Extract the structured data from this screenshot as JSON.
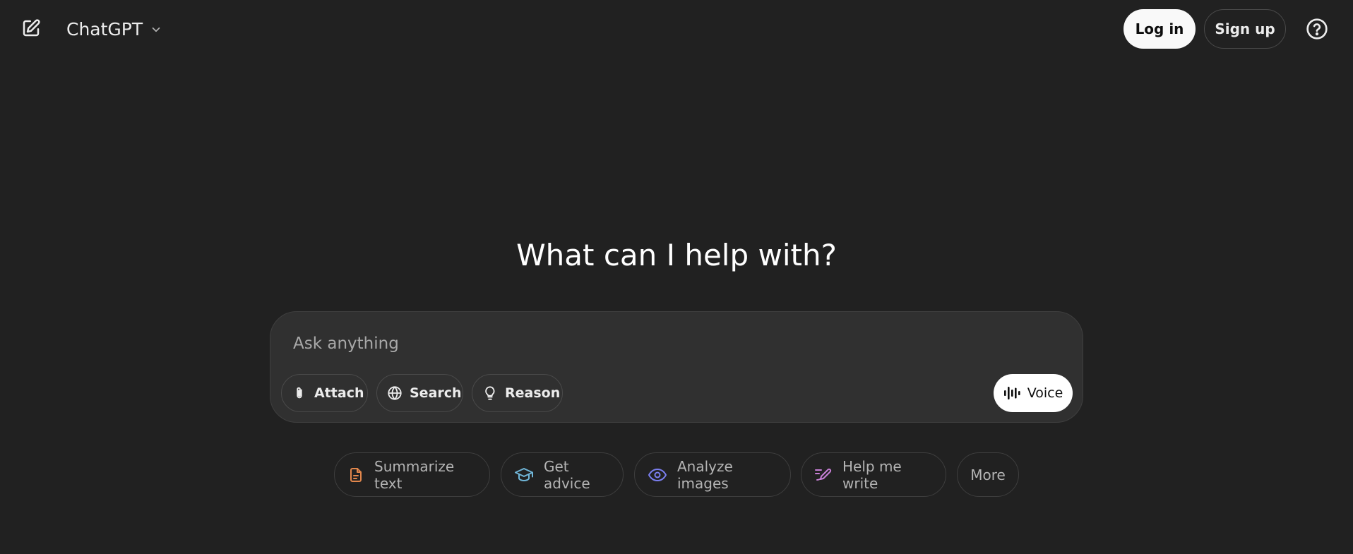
{
  "header": {
    "model_name": "ChatGPT",
    "login_label": "Log in",
    "signup_label": "Sign up",
    "icons": {
      "new_chat": "new-chat-icon",
      "model_chevron": "chevron-down-icon",
      "help": "help-circle-icon"
    }
  },
  "main": {
    "headline": "What can I help with?"
  },
  "composer": {
    "placeholder": "Ask anything",
    "value": "",
    "tools": [
      {
        "label": "Attach",
        "icon": "paperclip-icon"
      },
      {
        "label": "Search",
        "icon": "globe-icon"
      },
      {
        "label": "Reason",
        "icon": "lightbulb-icon"
      }
    ],
    "voice_label": "Voice",
    "voice_icon": "voice-waveform-icon"
  },
  "suggestions": [
    {
      "label": "Summarize text",
      "icon": "document-icon",
      "color": "#e2874c"
    },
    {
      "label": "Get advice",
      "icon": "graduation-cap-icon",
      "color": "#71b7d9"
    },
    {
      "label": "Analyze images",
      "icon": "eye-icon",
      "color": "#7b7ff0"
    },
    {
      "label": "Help me write",
      "icon": "pen-icon",
      "color": "#c77fd6"
    },
    {
      "label": "More",
      "icon": "",
      "color": "#b4b4b4"
    }
  ],
  "colors": {
    "background": "#212121",
    "composer_bg": "#303030",
    "text_primary": "#ececec",
    "text_muted": "#b4b4b4"
  }
}
